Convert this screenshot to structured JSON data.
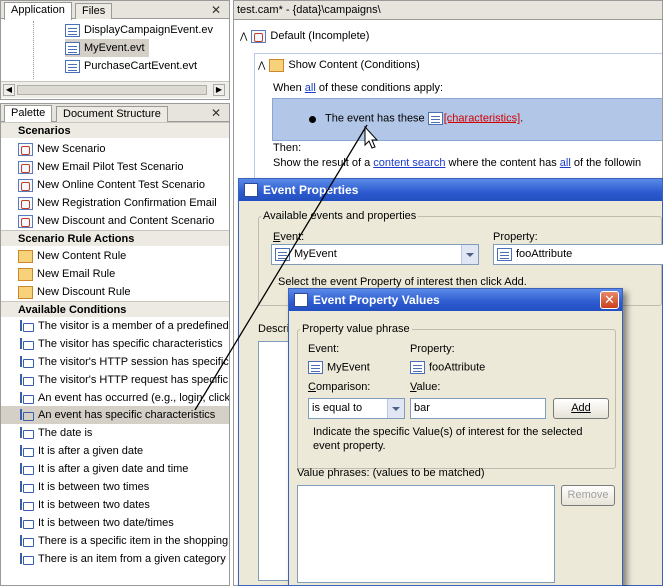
{
  "navigator": {
    "tabs": [
      "Application",
      "Files"
    ],
    "files": [
      "DisplayCampaignEvent.ev",
      "MyEvent.evt",
      "PurchaseCartEvent.evt"
    ]
  },
  "palette": {
    "tabs": [
      "Palette",
      "Document Structure"
    ],
    "sections": {
      "scenarios": "Scenarios",
      "rule_actions": "Scenario Rule Actions",
      "conditions": "Available Conditions"
    },
    "scenarios": [
      "New Scenario",
      "New Email Pilot Test Scenario",
      "New Online Content Test Scenario",
      "New Registration Confirmation Email",
      "New Discount and Content Scenario"
    ],
    "rule_actions": [
      "New Content Rule",
      "New Email Rule",
      "New Discount Rule"
    ],
    "conditions": [
      "The visitor is a member of a predefined",
      "The visitor has specific characteristics",
      "The visitor's HTTP session has specific p",
      "The visitor's HTTP request has specific p",
      "An event has occurred (e.g., login, click",
      "An event has specific characteristics",
      "The date is",
      "It is after a given date",
      "It is after a given date and time",
      "It is between two times",
      "It is between two dates",
      "It is between two date/times",
      "There is a specific item in the shopping c",
      "There is an item from a given category i"
    ]
  },
  "editor": {
    "tab_title": "test.cam* - {data}\\campaigns\\",
    "node_default": "Default (Incomplete)",
    "node_show": "Show Content (Conditions)",
    "when_prefix": "When ",
    "when_link": "all",
    "when_suffix": " of these conditions apply:",
    "condition_text": "The event has these ",
    "condition_link": "[characteristics]",
    "condition_end": ".",
    "then_label": "Then:",
    "show_prefix": "Show the result of a ",
    "show_link1": "content search",
    "show_mid": " where the content has ",
    "show_link2": "all",
    "show_suffix": " of the followin"
  },
  "event_properties": {
    "title": "Event Properties",
    "group_label": "Available events and properties",
    "event_label": "Event:",
    "event_value": "MyEvent",
    "property_label": "Property:",
    "property_value": "fooAttribute",
    "hint": "Select the event Property of interest then click Add.",
    "description_label": "Descrip"
  },
  "event_property_values": {
    "title": "Event Property Values",
    "group_label": "Property value phrase",
    "event_label": "Event:",
    "event_value": "MyEvent",
    "property_label": "Property:",
    "property_value": "fooAttribute",
    "comparison_label": "Comparison:",
    "comparison_value": "is equal to",
    "value_label": "Value:",
    "value_input": "bar",
    "add_button": "Add",
    "hint": "Indicate the specific Value(s) of interest for the selected event property.",
    "phrases_label": "Value phrases:  (values to be matched)",
    "remove_button": "Remove"
  }
}
